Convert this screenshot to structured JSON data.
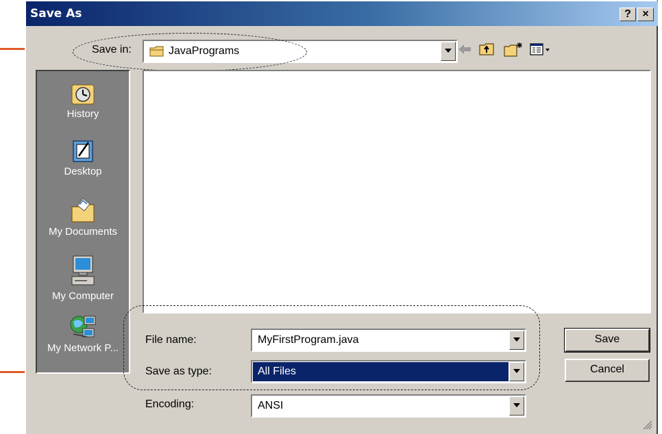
{
  "window": {
    "title": "Save As",
    "help_label": "?",
    "close_label": "×"
  },
  "save_in": {
    "label": "Save in:",
    "value": "JavaPrograms"
  },
  "toolbar": {
    "icons": [
      "back-arrow-icon",
      "up-one-level-icon",
      "create-new-folder-icon",
      "view-menu-icon"
    ]
  },
  "places": [
    {
      "label": "History",
      "icon": "history-icon"
    },
    {
      "label": "Desktop",
      "icon": "desktop-icon"
    },
    {
      "label": "My Documents",
      "icon": "my-documents-icon"
    },
    {
      "label": "My Computer",
      "icon": "my-computer-icon"
    },
    {
      "label": "My Network P...",
      "icon": "my-network-places-icon"
    }
  ],
  "file_name": {
    "label": "File name:",
    "value": "MyFirstProgram.java"
  },
  "save_as_type": {
    "label": "Save as type:",
    "value": "All Files"
  },
  "encoding": {
    "label": "Encoding:",
    "value": "ANSI"
  },
  "buttons": {
    "save": "Save",
    "cancel": "Cancel"
  },
  "colors": {
    "title_start": "#0a246a",
    "title_end": "#a6caf0",
    "face": "#d4d0c8",
    "selection": "#0a246a",
    "annotation_arrow": "#e35b2a"
  }
}
